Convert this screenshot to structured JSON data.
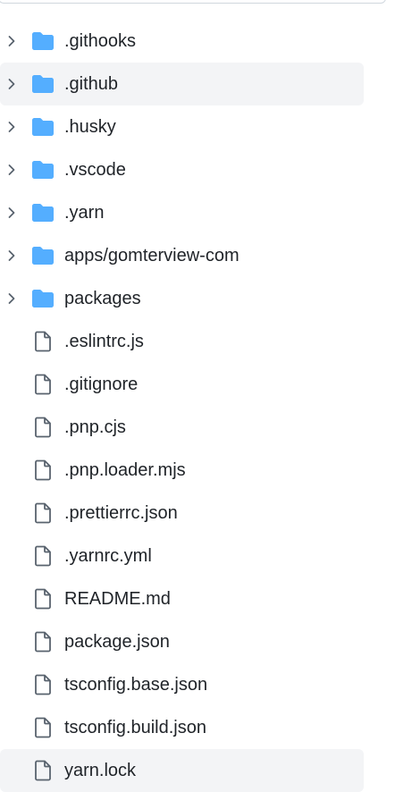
{
  "tree": {
    "items": [
      {
        "type": "folder",
        "name": ".githooks",
        "highlight": false
      },
      {
        "type": "folder",
        "name": ".github",
        "highlight": true
      },
      {
        "type": "folder",
        "name": ".husky",
        "highlight": false
      },
      {
        "type": "folder",
        "name": ".vscode",
        "highlight": false
      },
      {
        "type": "folder",
        "name": ".yarn",
        "highlight": false
      },
      {
        "type": "folder",
        "name": "apps/gomterview-com",
        "highlight": false
      },
      {
        "type": "folder",
        "name": "packages",
        "highlight": false
      },
      {
        "type": "file",
        "name": ".eslintrc.js",
        "highlight": false
      },
      {
        "type": "file",
        "name": ".gitignore",
        "highlight": false
      },
      {
        "type": "file",
        "name": ".pnp.cjs",
        "highlight": false
      },
      {
        "type": "file",
        "name": ".pnp.loader.mjs",
        "highlight": false
      },
      {
        "type": "file",
        "name": ".prettierrc.json",
        "highlight": false
      },
      {
        "type": "file",
        "name": ".yarnrc.yml",
        "highlight": false
      },
      {
        "type": "file",
        "name": "README.md",
        "highlight": false
      },
      {
        "type": "file",
        "name": "package.json",
        "highlight": false
      },
      {
        "type": "file",
        "name": "tsconfig.base.json",
        "highlight": false
      },
      {
        "type": "file",
        "name": "tsconfig.build.json",
        "highlight": false
      },
      {
        "type": "file",
        "name": "yarn.lock",
        "highlight": true
      }
    ]
  },
  "icons": {
    "folder": "folder-icon",
    "file": "file-icon",
    "chevron": "chevron-right-icon"
  },
  "colors": {
    "folder": "#54aeff",
    "file_stroke": "#59636e",
    "chevron": "#59636e",
    "text": "#1f2328",
    "highlight_bg": "#f3f4f6"
  }
}
